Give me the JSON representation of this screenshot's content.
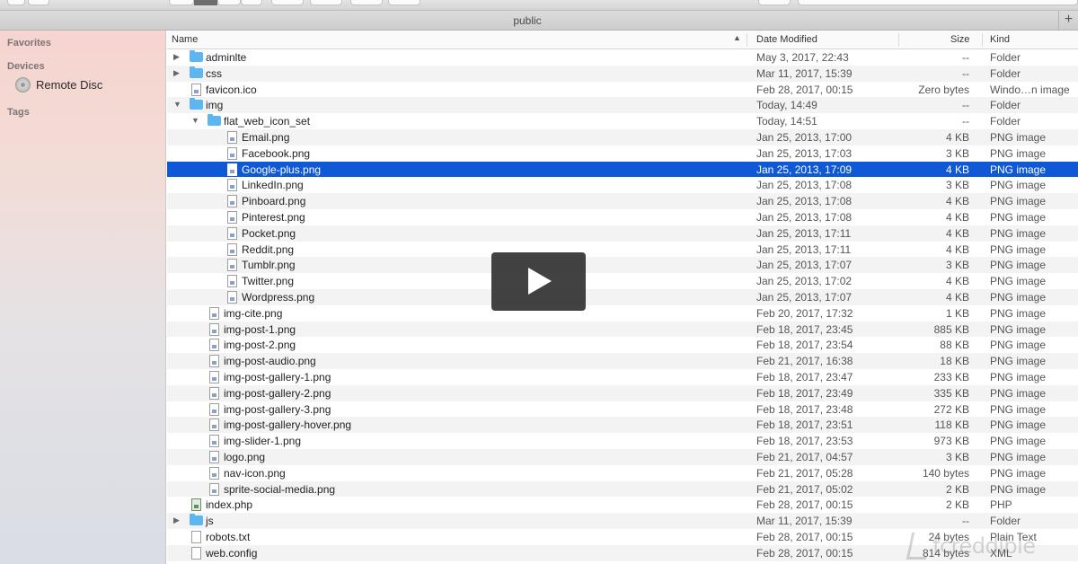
{
  "window": {
    "title": "public"
  },
  "sidebar": {
    "favorites_label": "Favorites",
    "devices_label": "Devices",
    "devices": [
      {
        "label": "Remote Disc",
        "icon": "disc-icon"
      }
    ],
    "tags_label": "Tags"
  },
  "columns": {
    "name": "Name",
    "date": "Date Modified",
    "size": "Size",
    "kind": "Kind"
  },
  "rows": [
    {
      "name": "adminlte",
      "date": "May 3, 2017, 22:43",
      "size": "--",
      "kind": "Folder",
      "icon": "folder-icon",
      "level": 0,
      "disclosure": "collapsed"
    },
    {
      "name": "css",
      "date": "Mar 11, 2017, 15:39",
      "size": "--",
      "kind": "Folder",
      "icon": "folder-icon",
      "level": 0,
      "disclosure": "collapsed"
    },
    {
      "name": "favicon.ico",
      "date": "Feb 28, 2017, 00:15",
      "size": "Zero bytes",
      "kind": "Windo…n image",
      "icon": "file-icon",
      "level": 0
    },
    {
      "name": "img",
      "date": "Today, 14:49",
      "size": "--",
      "kind": "Folder",
      "icon": "folder-icon",
      "level": 0,
      "disclosure": "expanded"
    },
    {
      "name": "flat_web_icon_set",
      "date": "Today, 14:51",
      "size": "--",
      "kind": "Folder",
      "icon": "folder-icon",
      "level": 1,
      "disclosure": "expanded"
    },
    {
      "name": "Email.png",
      "date": "Jan 25, 2013, 17:00",
      "size": "4 KB",
      "kind": "PNG image",
      "icon": "file-icon",
      "level": 2
    },
    {
      "name": "Facebook.png",
      "date": "Jan 25, 2013, 17:03",
      "size": "3 KB",
      "kind": "PNG image",
      "icon": "file-icon",
      "level": 2
    },
    {
      "name": "Google-plus.png",
      "date": "Jan 25, 2013, 17:09",
      "size": "4 KB",
      "kind": "PNG image",
      "icon": "file-icon",
      "level": 2,
      "selected": true
    },
    {
      "name": "LinkedIn.png",
      "date": "Jan 25, 2013, 17:08",
      "size": "3 KB",
      "kind": "PNG image",
      "icon": "file-icon",
      "level": 2
    },
    {
      "name": "Pinboard.png",
      "date": "Jan 25, 2013, 17:08",
      "size": "4 KB",
      "kind": "PNG image",
      "icon": "file-icon",
      "level": 2
    },
    {
      "name": "Pinterest.png",
      "date": "Jan 25, 2013, 17:08",
      "size": "4 KB",
      "kind": "PNG image",
      "icon": "file-icon",
      "level": 2
    },
    {
      "name": "Pocket.png",
      "date": "Jan 25, 2013, 17:11",
      "size": "4 KB",
      "kind": "PNG image",
      "icon": "file-icon",
      "level": 2
    },
    {
      "name": "Reddit.png",
      "date": "Jan 25, 2013, 17:11",
      "size": "4 KB",
      "kind": "PNG image",
      "icon": "file-icon",
      "level": 2
    },
    {
      "name": "Tumblr.png",
      "date": "Jan 25, 2013, 17:07",
      "size": "3 KB",
      "kind": "PNG image",
      "icon": "file-icon",
      "level": 2
    },
    {
      "name": "Twitter.png",
      "date": "Jan 25, 2013, 17:02",
      "size": "4 KB",
      "kind": "PNG image",
      "icon": "file-icon",
      "level": 2
    },
    {
      "name": "Wordpress.png",
      "date": "Jan 25, 2013, 17:07",
      "size": "4 KB",
      "kind": "PNG image",
      "icon": "file-icon",
      "level": 2
    },
    {
      "name": "img-cite.png",
      "date": "Feb 20, 2017, 17:32",
      "size": "1 KB",
      "kind": "PNG image",
      "icon": "file-icon",
      "level": 1
    },
    {
      "name": "img-post-1.png",
      "date": "Feb 18, 2017, 23:45",
      "size": "885 KB",
      "kind": "PNG image",
      "icon": "file-icon",
      "level": 1
    },
    {
      "name": "img-post-2.png",
      "date": "Feb 18, 2017, 23:54",
      "size": "88 KB",
      "kind": "PNG image",
      "icon": "file-icon",
      "level": 1
    },
    {
      "name": "img-post-audio.png",
      "date": "Feb 21, 2017, 16:38",
      "size": "18 KB",
      "kind": "PNG image",
      "icon": "file-icon",
      "level": 1
    },
    {
      "name": "img-post-gallery-1.png",
      "date": "Feb 18, 2017, 23:47",
      "size": "233 KB",
      "kind": "PNG image",
      "icon": "file-icon",
      "level": 1
    },
    {
      "name": "img-post-gallery-2.png",
      "date": "Feb 18, 2017, 23:49",
      "size": "335 KB",
      "kind": "PNG image",
      "icon": "file-icon",
      "level": 1
    },
    {
      "name": "img-post-gallery-3.png",
      "date": "Feb 18, 2017, 23:48",
      "size": "272 KB",
      "kind": "PNG image",
      "icon": "file-icon",
      "level": 1
    },
    {
      "name": "img-post-gallery-hover.png",
      "date": "Feb 18, 2017, 23:51",
      "size": "118 KB",
      "kind": "PNG image",
      "icon": "file-icon",
      "level": 1
    },
    {
      "name": "img-slider-1.png",
      "date": "Feb 18, 2017, 23:53",
      "size": "973 KB",
      "kind": "PNG image",
      "icon": "file-icon",
      "level": 1
    },
    {
      "name": "logo.png",
      "date": "Feb 21, 2017, 04:57",
      "size": "3 KB",
      "kind": "PNG image",
      "icon": "file-icon",
      "level": 1
    },
    {
      "name": "nav-icon.png",
      "date": "Feb 21, 2017, 05:28",
      "size": "140 bytes",
      "kind": "PNG image",
      "icon": "file-icon",
      "level": 1
    },
    {
      "name": "sprite-social-media.png",
      "date": "Feb 21, 2017, 05:02",
      "size": "2 KB",
      "kind": "PNG image",
      "icon": "file-icon",
      "level": 1
    },
    {
      "name": "index.php",
      "date": "Feb 28, 2017, 00:15",
      "size": "2 KB",
      "kind": "PHP",
      "icon": "php-file-icon",
      "level": 0
    },
    {
      "name": "js",
      "date": "Mar 11, 2017, 15:39",
      "size": "--",
      "kind": "Folder",
      "icon": "folder-icon",
      "level": 0,
      "disclosure": "collapsed"
    },
    {
      "name": "robots.txt",
      "date": "Feb 28, 2017, 00:15",
      "size": "24 bytes",
      "kind": "Plain Text",
      "icon": "text-file-icon",
      "level": 0
    },
    {
      "name": "web.config",
      "date": "Feb 28, 2017, 00:15",
      "size": "814 bytes",
      "kind": "XML",
      "icon": "text-file-icon",
      "level": 0
    }
  ],
  "overlay": {
    "icon": "play-icon"
  },
  "watermark": {
    "text": "fcreddible"
  },
  "colors": {
    "selection": "#0f58d6",
    "folder": "#5db6f0",
    "overlay": "#212121"
  }
}
